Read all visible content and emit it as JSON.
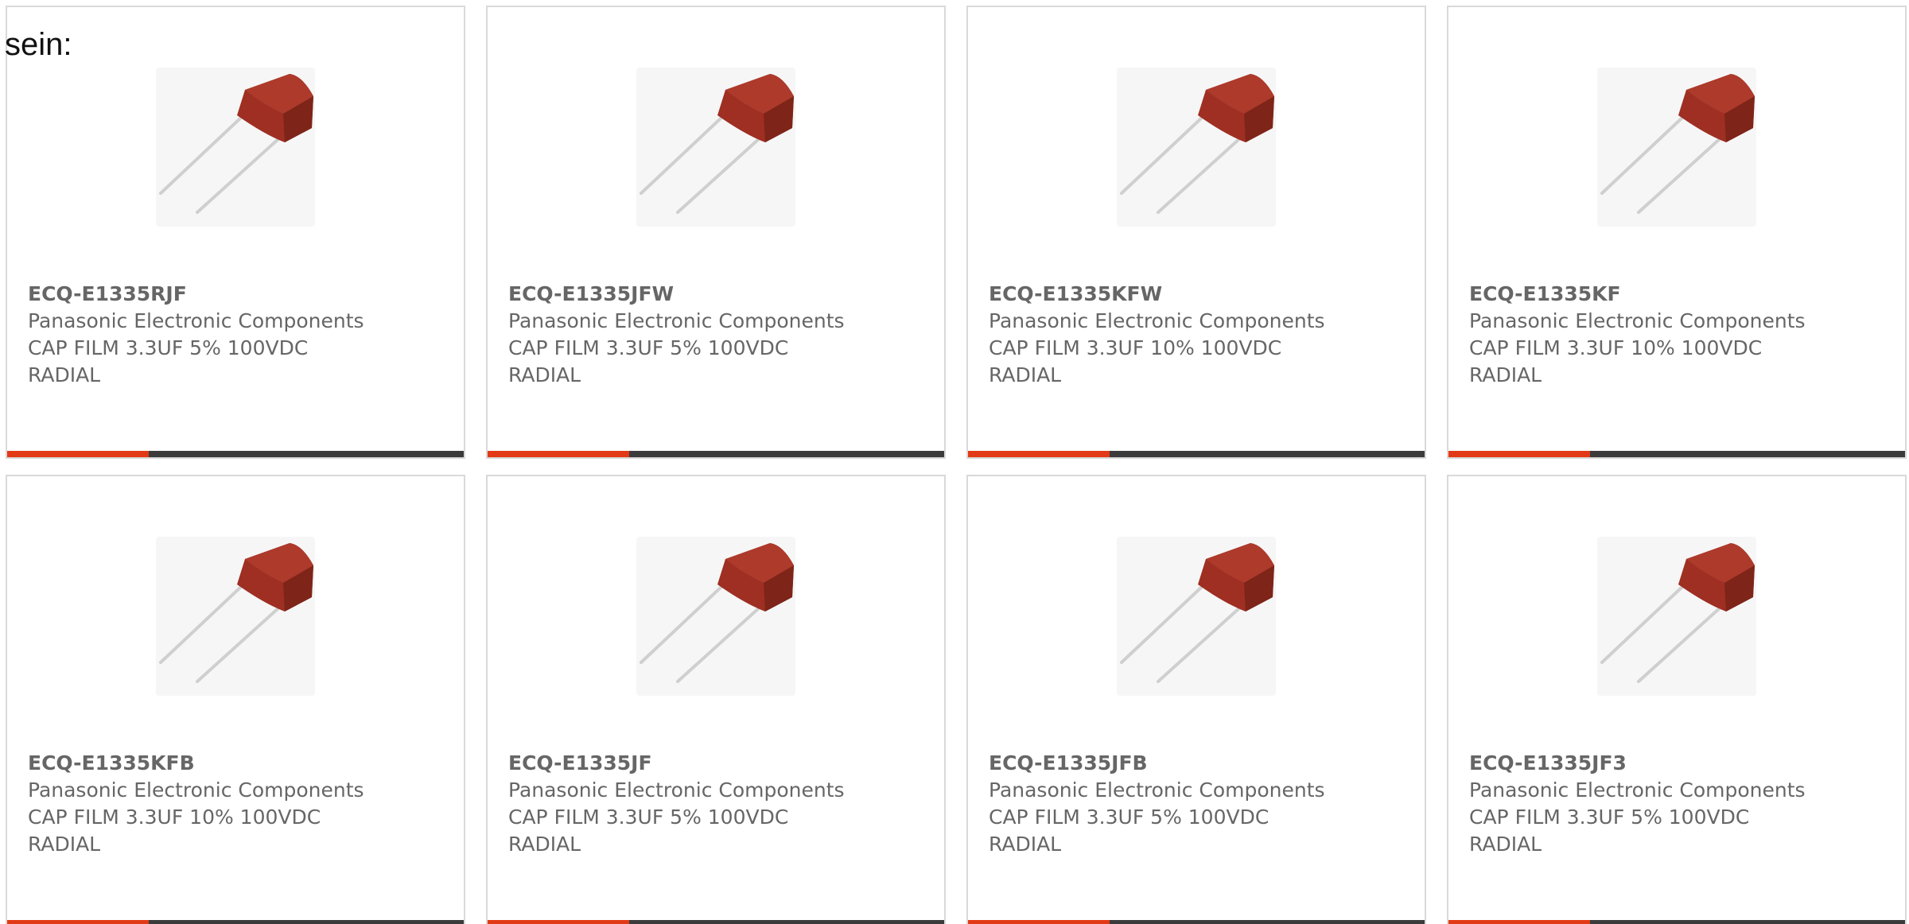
{
  "intro_text": "sein:",
  "colors": {
    "accent": "#e23a16",
    "bar_dark": "#3b3b3b",
    "capacitor_body": "#9e2f22",
    "text": "#666666"
  },
  "cards": [
    {
      "part": "ECQ-E1335RJF",
      "manufacturer": "Panasonic Electronic Components",
      "desc1": "CAP FILM 3.3UF 5% 100VDC",
      "desc2": "RADIAL",
      "accent_fraction": 0.31
    },
    {
      "part": "ECQ-E1335JFW",
      "manufacturer": "Panasonic Electronic Components",
      "desc1": "CAP FILM 3.3UF 5% 100VDC",
      "desc2": "RADIAL",
      "accent_fraction": 0.31
    },
    {
      "part": "ECQ-E1335KFW",
      "manufacturer": "Panasonic Electronic Components",
      "desc1": "CAP FILM 3.3UF 10% 100VDC",
      "desc2": "RADIAL",
      "accent_fraction": 0.31
    },
    {
      "part": "ECQ-E1335KF",
      "manufacturer": "Panasonic Electronic Components",
      "desc1": "CAP FILM 3.3UF 10% 100VDC",
      "desc2": "RADIAL",
      "accent_fraction": 0.31
    },
    {
      "part": "ECQ-E1335KFB",
      "manufacturer": "Panasonic Electronic Components",
      "desc1": "CAP FILM 3.3UF 10% 100VDC",
      "desc2": "RADIAL",
      "accent_fraction": 0.31
    },
    {
      "part": "ECQ-E1335JF",
      "manufacturer": "Panasonic Electronic Components",
      "desc1": "CAP FILM 3.3UF 5% 100VDC",
      "desc2": "RADIAL",
      "accent_fraction": 0.31
    },
    {
      "part": "ECQ-E1335JFB",
      "manufacturer": "Panasonic Electronic Components",
      "desc1": "CAP FILM 3.3UF 5% 100VDC",
      "desc2": "RADIAL",
      "accent_fraction": 0.31
    },
    {
      "part": "ECQ-E1335JF3",
      "manufacturer": "Panasonic Electronic Components",
      "desc1": "CAP FILM 3.3UF 5% 100VDC",
      "desc2": "RADIAL",
      "accent_fraction": 0.31
    }
  ]
}
